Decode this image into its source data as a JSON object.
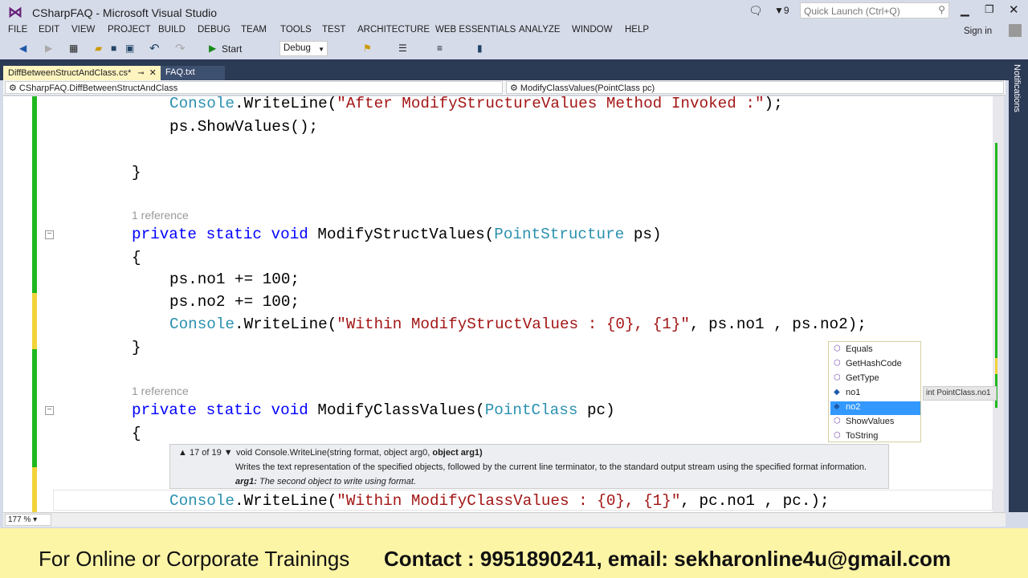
{
  "window": {
    "title": "CSharpFAQ - Microsoft Visual Studio",
    "notification_count": "9",
    "quick_launch_placeholder": "Quick Launch (Ctrl+Q)",
    "sign_in": "Sign in"
  },
  "menu": [
    "FILE",
    "EDIT",
    "VIEW",
    "PROJECT",
    "BUILD",
    "DEBUG",
    "TEAM",
    "TOOLS",
    "TEST",
    "ARCHITECTURE",
    "WEB ESSENTIALS",
    "ANALYZE",
    "WINDOW",
    "HELP"
  ],
  "toolbar": {
    "start": "Start",
    "config": "Debug"
  },
  "tabs": [
    {
      "label": "DiffBetweenStructAndClass.cs*"
    },
    {
      "label": "FAQ.txt"
    }
  ],
  "nav": {
    "type": "CSharpFAQ.DiffBetweenStructAndClass",
    "member": "ModifyClassValues(PointClass pc)"
  },
  "notifications_label": "Notifications",
  "code": {
    "l1": [
      [
        "ty",
        "Console"
      ],
      [
        "pl",
        ".WriteLine("
      ],
      [
        "st",
        "\"After ModifyStructureValues Method Invoked :\""
      ],
      [
        "pl",
        ");"
      ]
    ],
    "l2": [
      [
        "pl",
        "ps.ShowValues();"
      ]
    ],
    "l3": [
      [
        "pl",
        "}"
      ]
    ],
    "ref1": "1 reference",
    "l4": [
      [
        "kw",
        "private static void"
      ],
      [
        "pl",
        " ModifyStructValues("
      ],
      [
        "ty",
        "PointStructure"
      ],
      [
        "pl",
        " ps)"
      ]
    ],
    "l5": [
      [
        "pl",
        "{"
      ]
    ],
    "l6": [
      [
        "pl",
        "ps.no1 += 100;"
      ]
    ],
    "l7": [
      [
        "pl",
        "ps.no2 += 100;"
      ]
    ],
    "l8": [
      [
        "ty",
        "Console"
      ],
      [
        "pl",
        ".WriteLine("
      ],
      [
        "st",
        "\"Within ModifyStructValues : {0}, {1}\""
      ],
      [
        "pl",
        ", ps.no1 , ps.no2);"
      ]
    ],
    "l9": [
      [
        "pl",
        "}"
      ]
    ],
    "ref2": "1 reference",
    "l10": [
      [
        "kw",
        "private static void"
      ],
      [
        "pl",
        " ModifyClassValues("
      ],
      [
        "ty",
        "PointClass"
      ],
      [
        "pl",
        " pc)"
      ]
    ],
    "l11": [
      [
        "pl",
        "{"
      ]
    ],
    "l12": [
      [
        "ty",
        "Console"
      ],
      [
        "pl",
        ".WriteLine("
      ],
      [
        "st",
        "\"Within ModifyClassValues : {0}, {1}\""
      ],
      [
        "pl",
        ", pc.no1 , pc.);"
      ]
    ]
  },
  "tooltip": {
    "counter": "17 of 19",
    "signature_prefix": "void Console.WriteLine(string format, object arg0, ",
    "signature_bold": "object arg1)",
    "description": "Writes the text representation of the specified objects, followed by the current line terminator, to the standard output stream using the specified format information.",
    "param_name": "arg1:",
    "param_desc": "The second object to write using format."
  },
  "completion": {
    "items": [
      {
        "label": "Equals",
        "kind": "method"
      },
      {
        "label": "GetHashCode",
        "kind": "method"
      },
      {
        "label": "GetType",
        "kind": "method"
      },
      {
        "label": "no1",
        "kind": "field"
      },
      {
        "label": "no2",
        "kind": "field",
        "selected": true
      },
      {
        "label": "ShowValues",
        "kind": "method"
      },
      {
        "label": "ToString",
        "kind": "method"
      }
    ],
    "quickinfo": "int PointClass.no1"
  },
  "status": {
    "zoom": "177 %"
  },
  "banner": {
    "left": "For Online or Corporate Trainings",
    "right": "Contact : 9951890241, email: sekharonline4u@gmail.com"
  }
}
